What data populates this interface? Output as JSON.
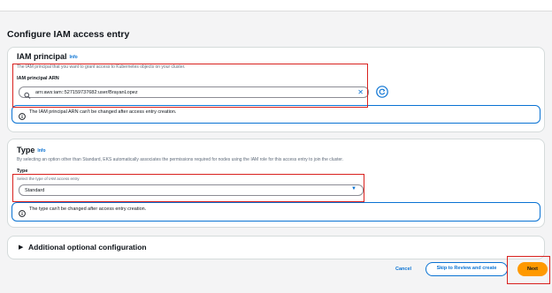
{
  "page": {
    "title": "Configure IAM access entry"
  },
  "principal": {
    "title": "IAM principal",
    "info": "Info",
    "description": "The IAM principal that you want to grant access to Kubernetes objects on your cluster.",
    "field_label": "IAM principal ARN",
    "value": "arn:aws:iam::527159737682:user/BrayanLopez",
    "alert": "The IAM principal ARN can't be changed after access entry creation."
  },
  "type": {
    "title": "Type",
    "info": "Info",
    "description": "By selecting an option other than Standard, EKS automatically associates the permissions required for nodes using the IAM role for this access entry to join the cluster.",
    "field_label": "Type",
    "field_hint": "Select the type of IAM access entry",
    "value": "Standard",
    "alert": "The type can't be changed after access entry creation."
  },
  "additional": {
    "title": "Additional optional configuration"
  },
  "actions": {
    "cancel": "Cancel",
    "skip": "Skip to Review and create",
    "next": "Next"
  },
  "colors": {
    "accent": "#0972d3",
    "primary_button": "#ff9900",
    "highlight": "#d9211e"
  }
}
